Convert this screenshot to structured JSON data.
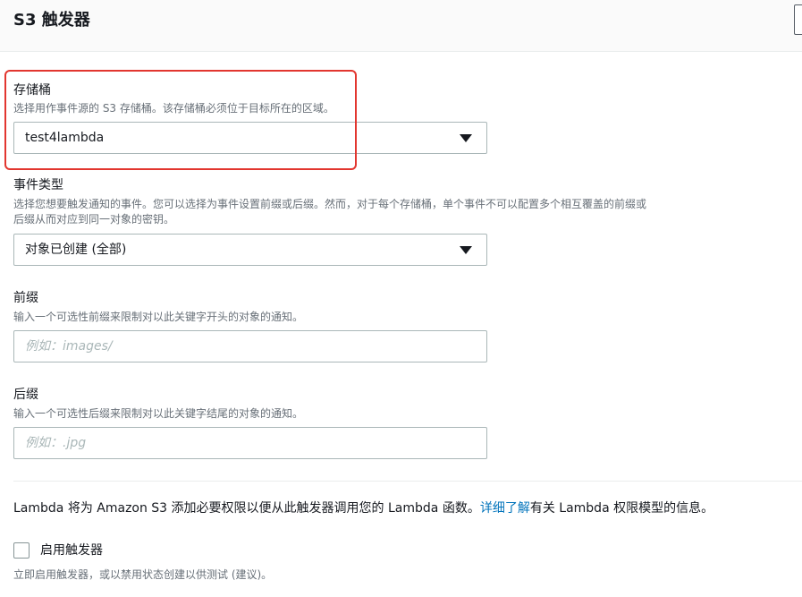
{
  "header": {
    "title": "S3 触发器"
  },
  "bucket": {
    "label": "存储桶",
    "description": "选择用作事件源的 S3 存储桶。该存储桶必须位于目标所在的区域。",
    "value": "test4lambda"
  },
  "event_type": {
    "label": "事件类型",
    "description_line1": "选择您想要触发通知的事件。您可以选择为事件设置前缀或后缀。然而，对于每个存储桶，单个事件不可以配置多个相互覆盖的前缀或",
    "description_line2": "后缀从而对应到同一对象的密钥。",
    "value": "对象已创建 (全部)"
  },
  "prefix": {
    "label": "前缀",
    "description": "输入一个可选性前缀来限制对以此关键字开头的对象的通知。",
    "placeholder": "例如：images/"
  },
  "suffix": {
    "label": "后缀",
    "description": "输入一个可选性后缀来限制对以此关键字结尾的对象的通知。",
    "placeholder": "例如：.jpg"
  },
  "info": {
    "text_before": "Lambda 将为 Amazon S3 添加必要权限以便从此触发器调用您的 Lambda 函数。",
    "link": "详细了解",
    "text_after": "有关 Lambda 权限模型的信息。"
  },
  "enable_trigger": {
    "label": "启用触发器",
    "checked": false,
    "description": "立即启用触发器，或以禁用状态创建以供测试 (建议)。"
  },
  "colors": {
    "highlight": "#e2362f",
    "link": "#0073bb",
    "border": "#aab7b8",
    "muted_text": "#687078"
  },
  "icons": {
    "dropdown": "caret-down-icon"
  }
}
